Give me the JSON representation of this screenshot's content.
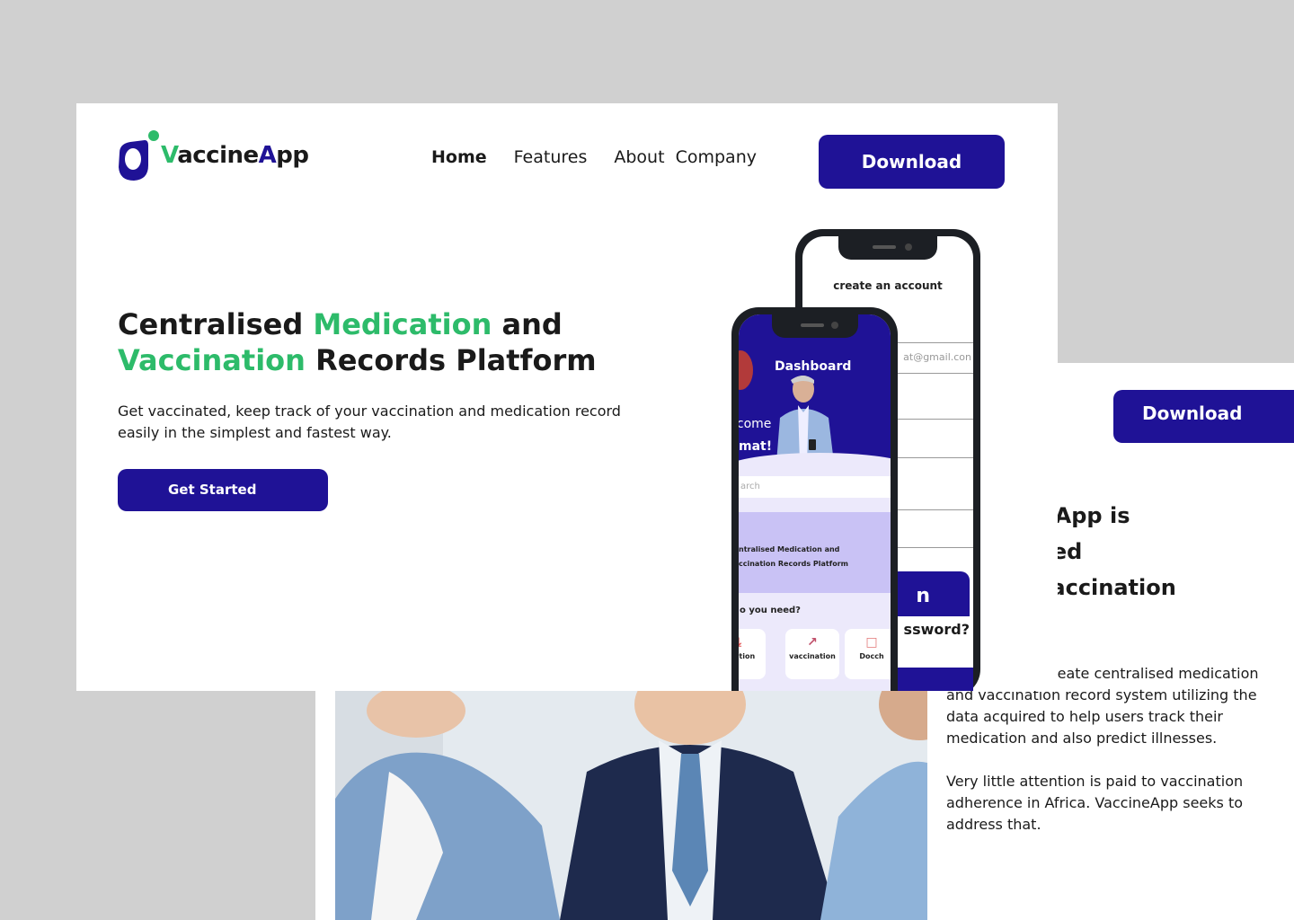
{
  "colors": {
    "primary": "#1f1296",
    "accent": "#2dbb6a",
    "text": "#1a1a1a",
    "backdrop": "#d0d0d0"
  },
  "back_card": {
    "download_label": "Download",
    "heading_lines": [
      "f vaccineApp is",
      "centralised",
      "on and vaccination"
    ],
    "body_paragraphs": [
      "cineApp is to create centralised medication and vaccination record system utilizing the data acquired to help users track their medication and also predict illnesses.",
      "Very little attention is paid to vaccination adherence in Africa. VaccineApp seeks to address that."
    ]
  },
  "header": {
    "logo": {
      "part1": "V",
      "part2": "accine",
      "part3": "A",
      "part4": "pp"
    },
    "nav": [
      {
        "label": "Home",
        "active": true
      },
      {
        "label": "Features",
        "active": false
      },
      {
        "label": "About  Company",
        "active": false
      }
    ],
    "download_label": "Download"
  },
  "hero": {
    "title": {
      "l1_a": "Centralised ",
      "l1_b": "Medication",
      "l1_c": " and",
      "l2_a": "Vaccination",
      "l2_b": " Records Platform"
    },
    "subtitle": "Get vaccinated, keep track of your vaccination and medication record easily in the simplest and fastest way.",
    "cta_label": "Get Started"
  },
  "phone_signup": {
    "title": "create an account",
    "email_placeholder": "at@gmail.con",
    "login_label": "n",
    "forgot_label": "ssword?"
  },
  "phone_dashboard": {
    "title": "Dashboard",
    "welcome": "lcome",
    "name": "mat!",
    "search_placeholder": "arch",
    "banner_line1": "ntralised Medication and",
    "banner_line2": "ccination Records Platform",
    "question": "o you need?",
    "tiles": [
      {
        "label": "dication",
        "icon": "download-icon"
      },
      {
        "label": "vaccination",
        "icon": "syringe-icon"
      },
      {
        "label": "Docch",
        "icon": "document-icon"
      }
    ]
  }
}
